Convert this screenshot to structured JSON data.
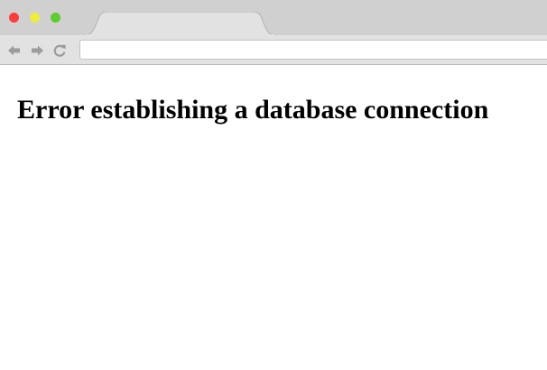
{
  "window": {
    "traffic_lights": {
      "close_color": "#fc3b3b",
      "minimize_color": "#eded3d",
      "maximize_color": "#5ccc2e"
    },
    "tab": {
      "title": ""
    },
    "toolbar": {
      "back_icon": "arrow-left-icon",
      "forward_icon": "arrow-right-icon",
      "reload_icon": "reload-icon",
      "address_value": ""
    }
  },
  "page": {
    "heading": "Error establishing a database connection"
  }
}
